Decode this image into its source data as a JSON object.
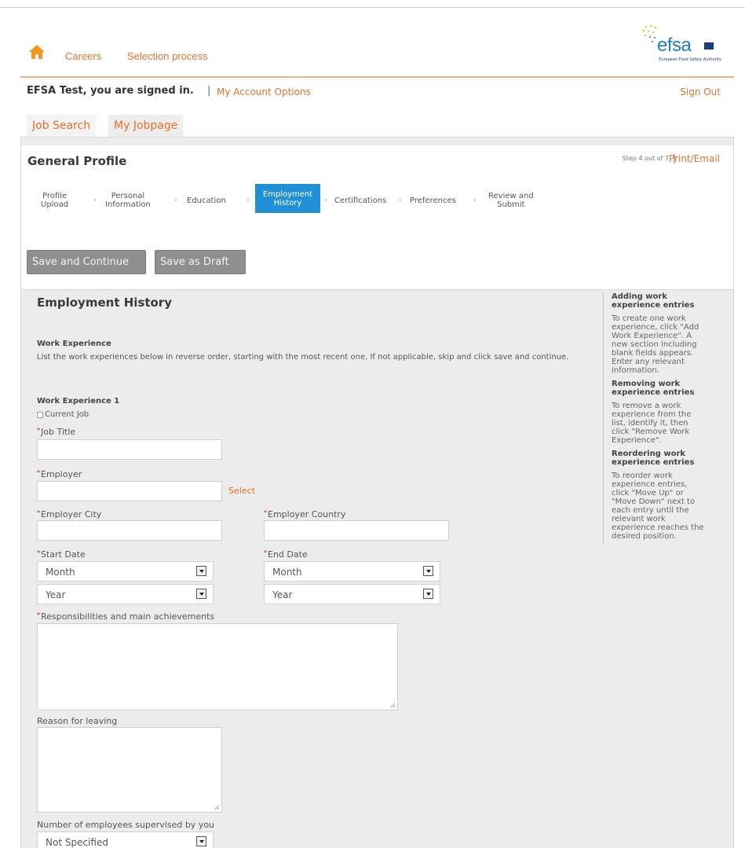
{
  "header": {
    "nav": [
      "Careers",
      "Selection process"
    ],
    "logo_text": "efsa",
    "logo_subtitle": "European Food Safety Authority"
  },
  "account": {
    "signed_in_text": "EFSA Test, you are signed in.",
    "account_options": "My Account Options",
    "sign_out": "Sign Out"
  },
  "tabs": [
    "Job Search",
    "My Jobpage"
  ],
  "profile": {
    "title": "General Profile",
    "step_info": "Step 4 out of 7",
    "print_email": "Print/Email",
    "steps": [
      {
        "label1": "Profile",
        "label2": "Upload"
      },
      {
        "label1": "Personal",
        "label2": "Information"
      },
      {
        "label1": "Education",
        "label2": ""
      },
      {
        "label1": "Employment",
        "label2": "History"
      },
      {
        "label1": "Certifications",
        "label2": ""
      },
      {
        "label1": "Preferences",
        "label2": ""
      },
      {
        "label1": "Review and",
        "label2": "Submit"
      }
    ],
    "save_continue": "Save and Continue",
    "save_draft": "Save as Draft"
  },
  "form": {
    "section_title": "Employment History",
    "subsection_title": "Work Experience",
    "instructions": "List the work experiences below in reverse order, starting with the most recent one. If not applicable, skip and click save and continue.",
    "entry_title": "Work Experience 1",
    "current_job": "Current Job",
    "job_title_label": "Job Title",
    "employer_label": "Employer",
    "select_link": "Select",
    "employer_city_label": "Employer City",
    "employer_country_label": "Employer Country",
    "start_date_label": "Start Date",
    "end_date_label": "End Date",
    "start_month": "Month",
    "start_year": "Year",
    "end_month": "Month",
    "end_year": "Year",
    "responsibilities_label": "Responsibilities and main achievements",
    "reason_label": "Reason for leaving",
    "supervised_label": "Number of employees supervised by you",
    "supervised_value": "Not Specified",
    "required_marker": "*"
  },
  "help": {
    "adding_title": "Adding work experience entries",
    "adding_text": "To create one work experience, click \"Add Work Experience\". A new section including blank fields appears. Enter any relevant information.",
    "removing_title": "Removing work experience entries",
    "removing_text": "To remove a work experience from the list, identify it, then click \"Remove Work Experience\".",
    "reordering_title": "Reordering work experience entries",
    "reordering_text": "To reorder work experience entries, click \"Move Up\" or \"Move Down\" next to each entry until the relevant work experience reaches the desired position."
  },
  "colors": {
    "accent": "#e8702a",
    "active_step": "#1f8fd6",
    "button": "#8f8f8f",
    "form_bg": "#ececec"
  }
}
